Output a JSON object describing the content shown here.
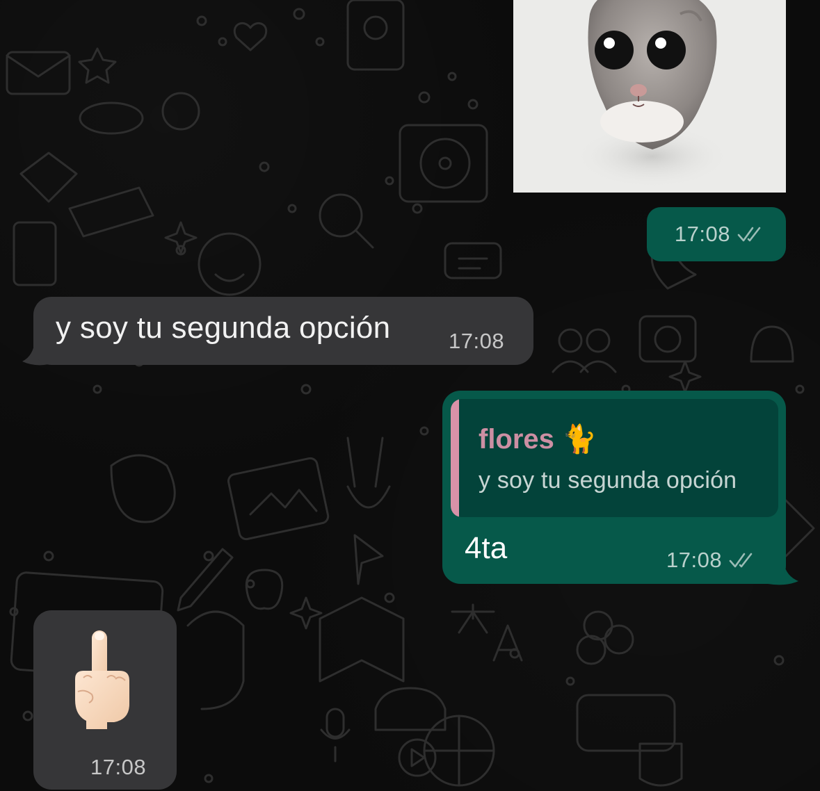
{
  "messages": {
    "outgoing_image": {
      "image_subject": "hamster",
      "time": "17:08",
      "status_icon": "double-check-icon"
    },
    "incoming_text": {
      "text": "y soy tu segunda opción",
      "time": "17:08"
    },
    "outgoing_reply": {
      "quoted_author": "flores 🐈",
      "quoted_text": "y soy tu segunda opción",
      "text": "4ta",
      "time": "17:08",
      "status_icon": "double-check-icon"
    },
    "incoming_emoji": {
      "emoji": "middle-finger-emoji",
      "time": "17:08"
    }
  },
  "colors": {
    "outgoing_bubble": "#06594a",
    "incoming_bubble": "#363638",
    "quote_bar": "#d892a8",
    "quote_author": "#cc8fa3",
    "background": "#0c0c0c"
  }
}
